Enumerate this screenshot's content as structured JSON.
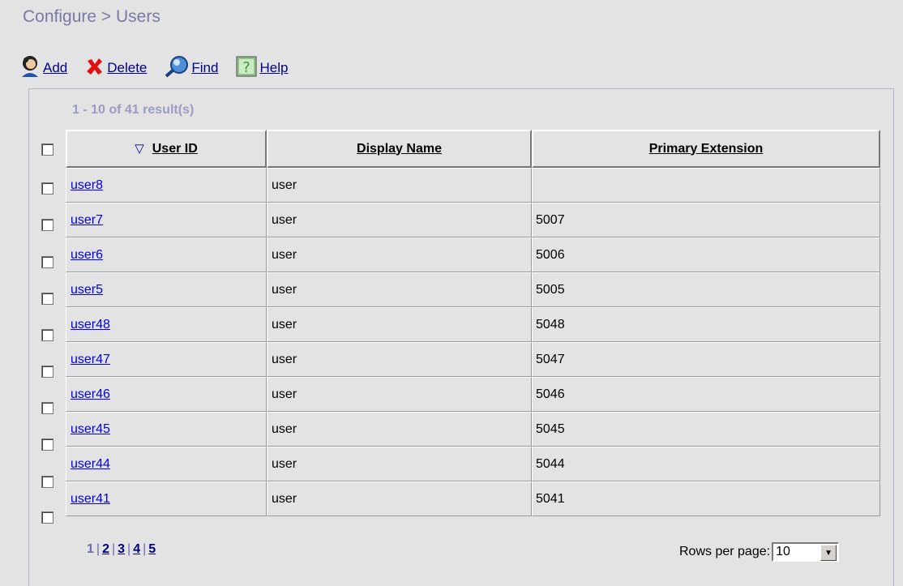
{
  "page": {
    "title": "Configure > Users"
  },
  "toolbar": {
    "add_label": "Add",
    "delete_label": "Delete",
    "find_label": "Find",
    "help_label": "Help"
  },
  "results": {
    "count_text": "1 - 10 of 41 result(s)"
  },
  "table": {
    "headers": [
      "User ID",
      "Display Name",
      "Primary Extension"
    ],
    "sort_indicator": "▽",
    "rows": [
      {
        "user_id": "user8",
        "display_name": "user",
        "extension": ""
      },
      {
        "user_id": "user7",
        "display_name": "user",
        "extension": "5007"
      },
      {
        "user_id": "user6",
        "display_name": "user",
        "extension": "5006"
      },
      {
        "user_id": "user5",
        "display_name": "user",
        "extension": "5005"
      },
      {
        "user_id": "user48",
        "display_name": "user",
        "extension": "5048"
      },
      {
        "user_id": "user47",
        "display_name": "user",
        "extension": "5047"
      },
      {
        "user_id": "user46",
        "display_name": "user",
        "extension": "5046"
      },
      {
        "user_id": "user45",
        "display_name": "user",
        "extension": "5045"
      },
      {
        "user_id": "user44",
        "display_name": "user",
        "extension": "5044"
      },
      {
        "user_id": "user41",
        "display_name": "user",
        "extension": "5041"
      }
    ]
  },
  "pagination": {
    "pages": [
      "1",
      "2",
      "3",
      "4",
      "5"
    ],
    "current": "1"
  },
  "rows_per_page": {
    "label": "Rows per page:",
    "value": "10"
  },
  "icons": {
    "add": "user-add-icon",
    "delete": "red-x-icon",
    "find": "magnifier-icon",
    "help": "question-icon",
    "sort": "sort-down-triangle-icon"
  },
  "colors": {
    "title": "#7a7aa6",
    "link": "#0000ee",
    "background": "#e3e3e3"
  }
}
